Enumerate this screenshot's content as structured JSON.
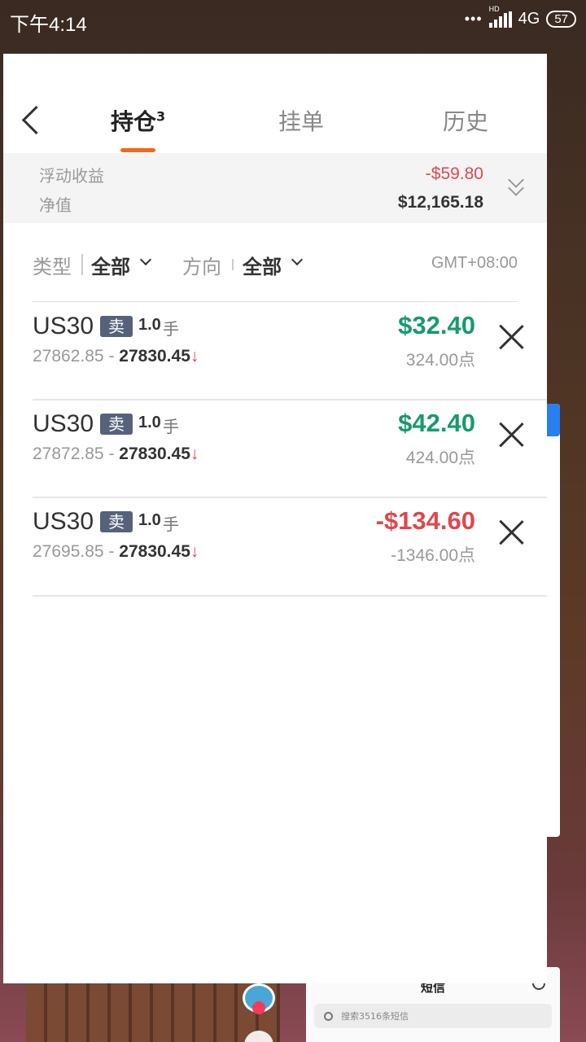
{
  "status_bar": {
    "time": "下午4:14",
    "hd": "HD",
    "network": "4G",
    "battery": "57"
  },
  "header": {
    "tabs": [
      {
        "label": "持仓",
        "badge": "3"
      },
      {
        "label": "挂单"
      },
      {
        "label": "历史"
      }
    ],
    "accent_color": "#f06a1e"
  },
  "summary": {
    "floating_pnl_label": "浮动收益",
    "floating_pnl_value": "-$59.80",
    "equity_label": "净值",
    "equity_value": "$12,165.18"
  },
  "filters": {
    "type_label": "类型",
    "type_value": "全部",
    "direction_label": "方向",
    "direction_value": "全部",
    "timezone": "GMT+08:00"
  },
  "positions": [
    {
      "symbol": "US30",
      "side": "卖",
      "lots": "1.0",
      "lots_unit": "手",
      "open_price": "27862.85",
      "separator": "-",
      "current_price": "27830.45",
      "trend_arrow": "↓",
      "pnl": "$32.40",
      "points": "324.00",
      "points_unit": "点"
    },
    {
      "symbol": "US30",
      "side": "卖",
      "lots": "1.0",
      "lots_unit": "手",
      "open_price": "27872.85",
      "separator": "-",
      "current_price": "27830.45",
      "trend_arrow": "↓",
      "pnl": "$42.40",
      "points": "424.00",
      "points_unit": "点"
    },
    {
      "symbol": "US30",
      "side": "卖",
      "lots": "1.0",
      "lots_unit": "手",
      "open_price": "27695.85",
      "separator": "-",
      "current_price": "27830.45",
      "trend_arrow": "↓",
      "pnl": "-$134.60",
      "points": "-1346.00",
      "points_unit": "点"
    }
  ],
  "colors": {
    "profit": "#179a6c",
    "loss": "#e0474c",
    "side_badge": "#56627c"
  },
  "background_apps": {
    "sms": {
      "title": "短信",
      "search_placeholder": "搜索3516条短信"
    }
  }
}
